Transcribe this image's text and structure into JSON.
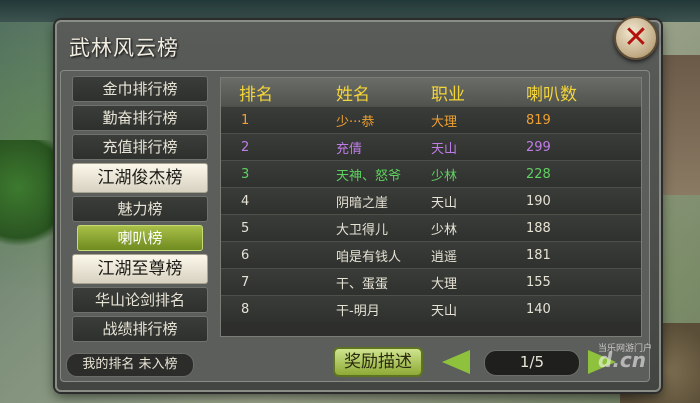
{
  "window": {
    "title": "武林风云榜"
  },
  "sidebar": {
    "items": [
      {
        "label": "金巾排行榜",
        "kind": "item"
      },
      {
        "label": "勤奋排行榜",
        "kind": "item"
      },
      {
        "label": "充值排行榜",
        "kind": "item"
      },
      {
        "label": "江湖俊杰榜",
        "kind": "header"
      },
      {
        "label": "魅力榜",
        "kind": "item"
      },
      {
        "label": "喇叭榜",
        "kind": "active"
      },
      {
        "label": "江湖至尊榜",
        "kind": "header"
      },
      {
        "label": "华山论剑排名",
        "kind": "item"
      },
      {
        "label": "战绩排行榜",
        "kind": "item"
      }
    ],
    "my_rank": "我的排名  未入榜"
  },
  "table": {
    "headers": [
      "排名",
      "姓名",
      "职业",
      "喇叭数"
    ],
    "rows": [
      {
        "rank": "1",
        "name": "少···恭",
        "class": "大理",
        "count": "819",
        "color": "#f0a030"
      },
      {
        "rank": "2",
        "name": "充倩",
        "class": "天山",
        "count": "299",
        "color": "#c07de8"
      },
      {
        "rank": "3",
        "name": "天神、怒爷",
        "class": "少林",
        "count": "228",
        "color": "#5fd060"
      },
      {
        "rank": "4",
        "name": "阴暗之崖",
        "class": "天山",
        "count": "190",
        "color": "#e6e2d4"
      },
      {
        "rank": "5",
        "name": "大卫得儿",
        "class": "少林",
        "count": "188",
        "color": "#e6e2d4"
      },
      {
        "rank": "6",
        "name": "咱是有钱人",
        "class": "逍遥",
        "count": "181",
        "color": "#e6e2d4"
      },
      {
        "rank": "7",
        "name": "干、蛋蛋",
        "class": "大理",
        "count": "155",
        "color": "#e6e2d4"
      },
      {
        "rank": "8",
        "name": "干-明月",
        "class": "天山",
        "count": "140",
        "color": "#e6e2d4"
      }
    ]
  },
  "footer": {
    "reward_label": "奖励描述",
    "page": "1/5"
  },
  "watermark": {
    "line1": "当乐网游门户",
    "line2": "d.cn"
  },
  "icons": {
    "close": "close-icon",
    "prev": "arrow-left-icon",
    "next": "arrow-right-icon"
  }
}
